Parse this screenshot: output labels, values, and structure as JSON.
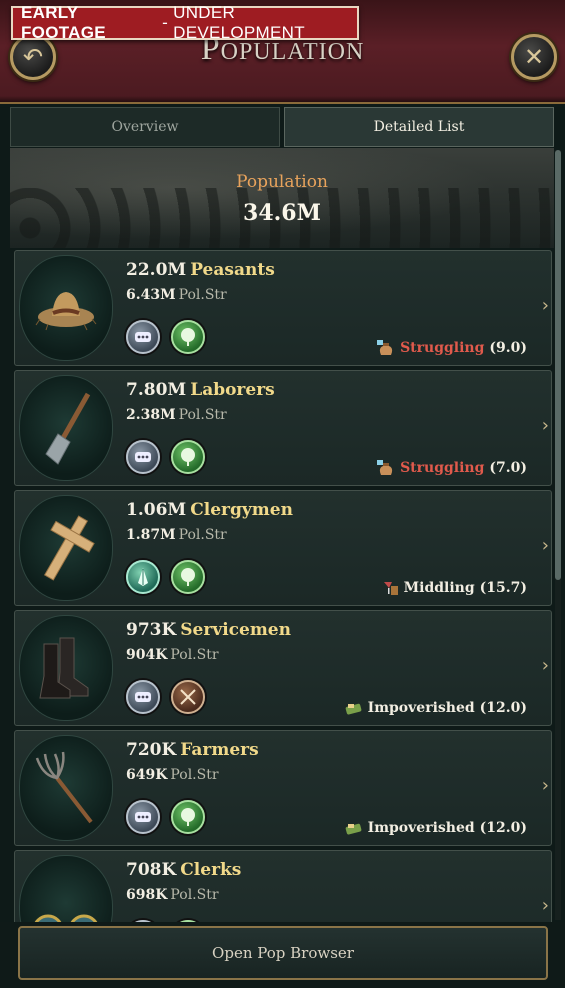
{
  "banner": {
    "strong": "EARLY FOOTAGE",
    "separator": "-",
    "rest": "UNDER DEVELOPMENT"
  },
  "header": {
    "title": "Population"
  },
  "tabs": [
    {
      "label": "Overview",
      "active": false
    },
    {
      "label": "Detailed List",
      "active": true
    }
  ],
  "hero": {
    "label": "Population",
    "value": "34.6M"
  },
  "pops": [
    {
      "size": "22.0M",
      "name": "Peasants",
      "pol_str": "6.43M",
      "pol_label": "Pol.Str",
      "status": "Struggling",
      "status_value": "(9.0)"
    },
    {
      "size": "7.80M",
      "name": "Laborers",
      "pol_str": "2.38M",
      "pol_label": "Pol.Str",
      "status": "Struggling",
      "status_value": "(7.0)"
    },
    {
      "size": "1.06M",
      "name": "Clergymen",
      "pol_str": "1.87M",
      "pol_label": "Pol.Str",
      "status": "Middling",
      "status_value": "(15.7)"
    },
    {
      "size": "973K",
      "name": "Servicemen",
      "pol_str": "904K",
      "pol_label": "Pol.Str",
      "status": "Impoverished",
      "status_value": "(12.0)"
    },
    {
      "size": "720K",
      "name": "Farmers",
      "pol_str": "649K",
      "pol_label": "Pol.Str",
      "status": "Impoverished",
      "status_value": "(12.0)"
    },
    {
      "size": "708K",
      "name": "Clerks",
      "pol_str": "698K",
      "pol_label": "Pol.Str"
    }
  ],
  "footer": {
    "button": "Open Pop Browser"
  },
  "colors": {
    "accent": "#f1d98a",
    "struggling": "#e05a4c",
    "header": "#5a1f26"
  }
}
